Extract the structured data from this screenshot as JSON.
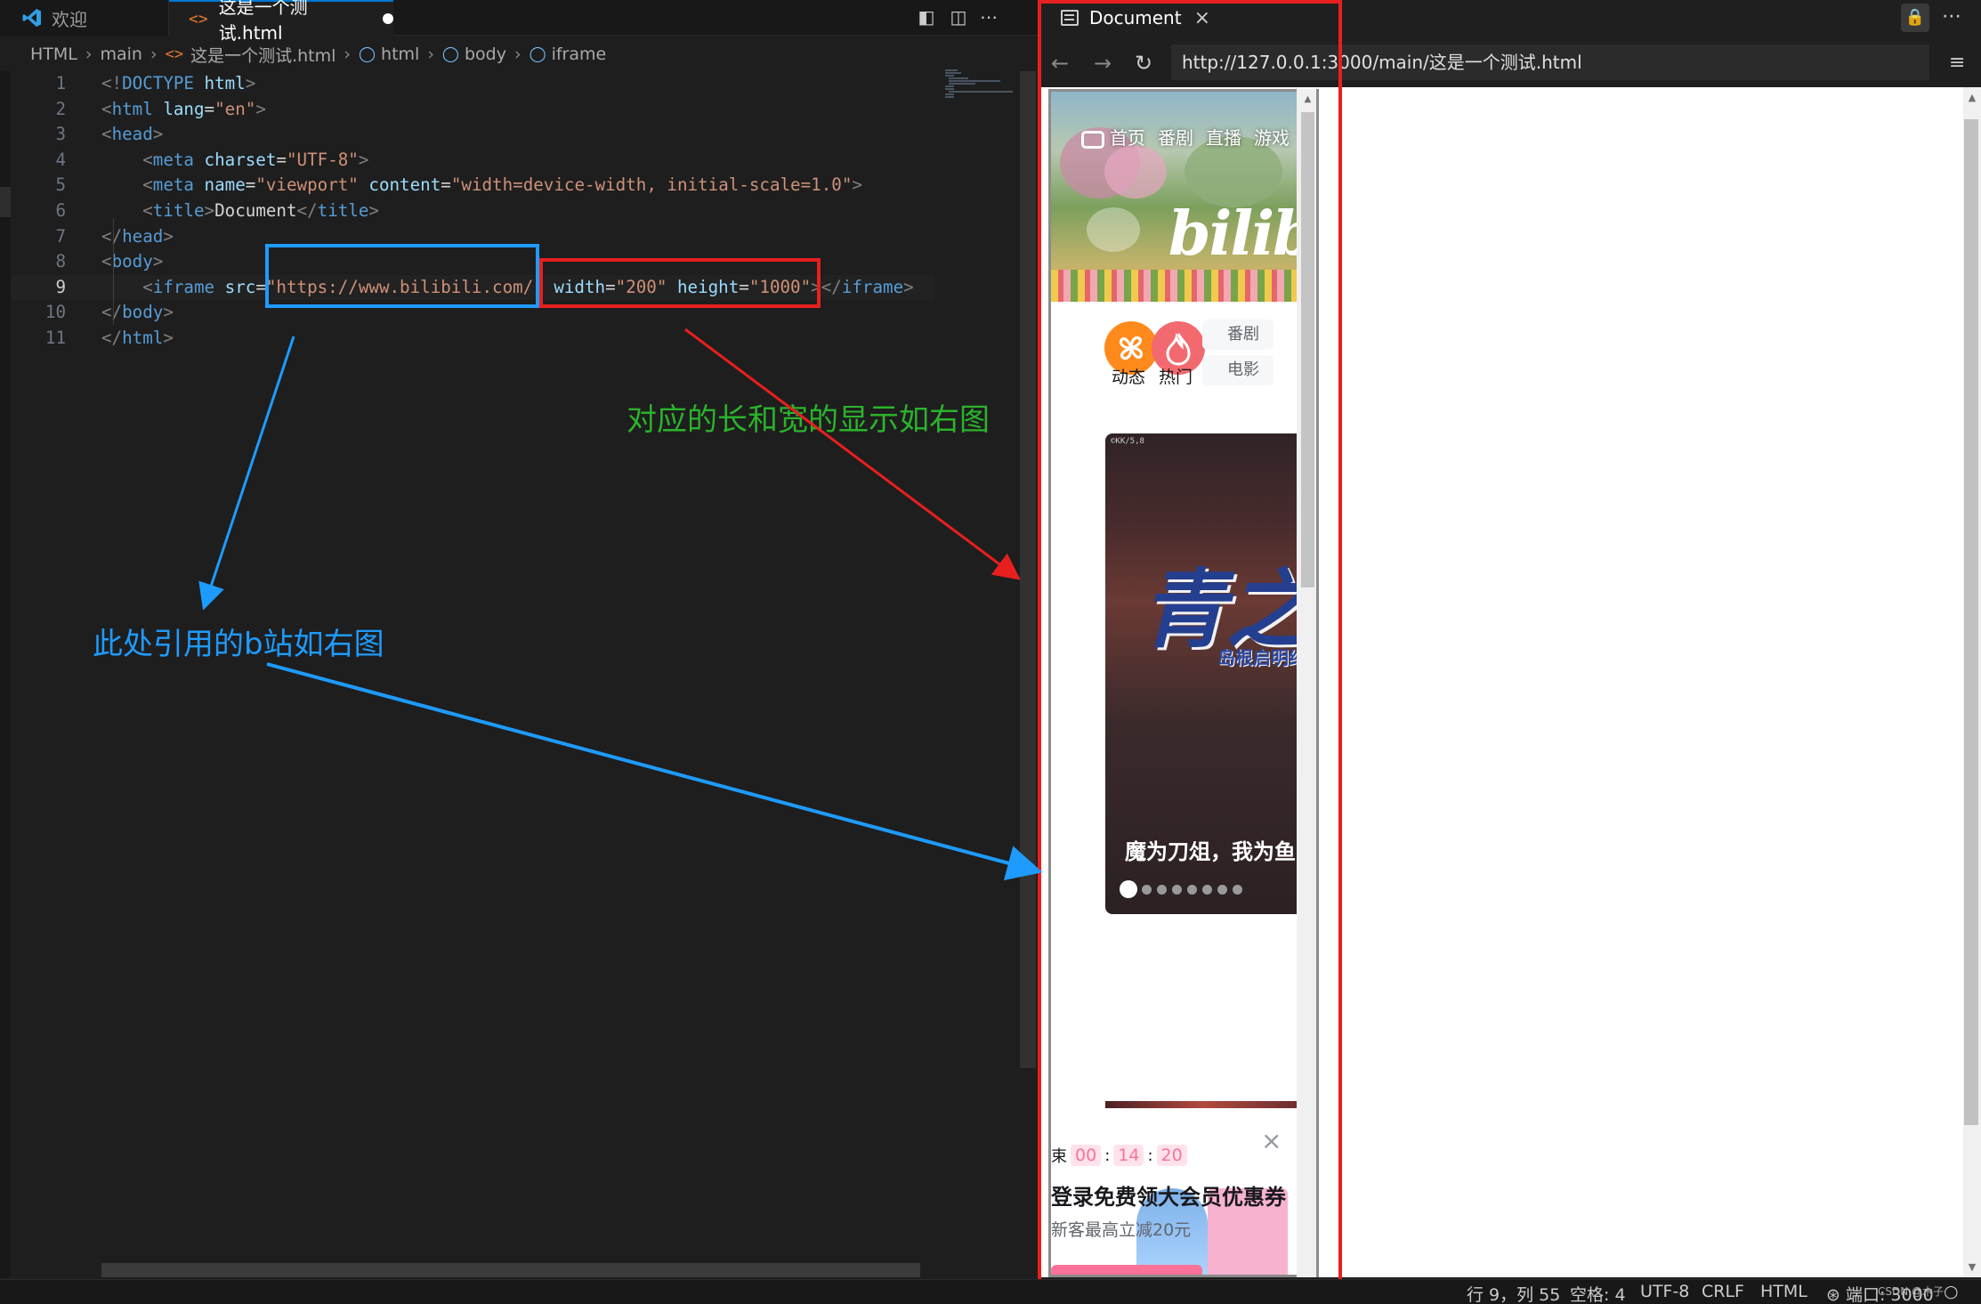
{
  "tabs": [
    {
      "label": "欢迎"
    },
    {
      "label": "这是一个测试.html"
    }
  ],
  "breadcrumb": [
    "HTML",
    "main",
    "这是一个测试.html",
    "html",
    "body",
    "iframe"
  ],
  "editor": {
    "current_line": 9,
    "lines": [
      {
        "n": "1",
        "tokens": [
          [
            "br",
            "<!"
          ],
          [
            "tag",
            "DOCTYPE "
          ],
          [
            "attr",
            "html"
          ],
          [
            "br",
            ">"
          ]
        ]
      },
      {
        "n": "2",
        "tokens": [
          [
            "br",
            "<"
          ],
          [
            "tag",
            "html "
          ],
          [
            "attr",
            "lang"
          ],
          [
            "txt",
            "="
          ],
          [
            "str",
            "\"en\""
          ],
          [
            "br",
            ">"
          ]
        ]
      },
      {
        "n": "3",
        "tokens": [
          [
            "br",
            "<"
          ],
          [
            "tag",
            "head"
          ],
          [
            "br",
            ">"
          ]
        ]
      },
      {
        "n": "4",
        "tokens": [
          [
            "txt",
            "    "
          ],
          [
            "br",
            "<"
          ],
          [
            "tag",
            "meta "
          ],
          [
            "attr",
            "charset"
          ],
          [
            "txt",
            "="
          ],
          [
            "str",
            "\"UTF-8\""
          ],
          [
            "br",
            ">"
          ]
        ]
      },
      {
        "n": "5",
        "tokens": [
          [
            "txt",
            "    "
          ],
          [
            "br",
            "<"
          ],
          [
            "tag",
            "meta "
          ],
          [
            "attr",
            "name"
          ],
          [
            "txt",
            "="
          ],
          [
            "str",
            "\"viewport\" "
          ],
          [
            "attr",
            "content"
          ],
          [
            "txt",
            "="
          ],
          [
            "str",
            "\"width=device-width, initial-scale=1.0\""
          ],
          [
            "br",
            ">"
          ]
        ]
      },
      {
        "n": "6",
        "tokens": [
          [
            "txt",
            "    "
          ],
          [
            "br",
            "<"
          ],
          [
            "tag",
            "title"
          ],
          [
            "br",
            ">"
          ],
          [
            "txt",
            "Document"
          ],
          [
            "br",
            "</"
          ],
          [
            "tag",
            "title"
          ],
          [
            "br",
            ">"
          ]
        ]
      },
      {
        "n": "7",
        "tokens": [
          [
            "br",
            "</"
          ],
          [
            "tag",
            "head"
          ],
          [
            "br",
            ">"
          ]
        ]
      },
      {
        "n": "8",
        "tokens": [
          [
            "br",
            "<"
          ],
          [
            "tag",
            "body"
          ],
          [
            "br",
            ">"
          ]
        ]
      },
      {
        "n": "9",
        "tokens": [
          [
            "txt",
            "    "
          ],
          [
            "br",
            "<"
          ],
          [
            "tag",
            "iframe "
          ],
          [
            "attr",
            "src"
          ],
          [
            "txt",
            "="
          ],
          [
            "str",
            "\"https://www.bilibili.com/\" "
          ],
          [
            "attr",
            "width"
          ],
          [
            "txt",
            "="
          ],
          [
            "str",
            "\"200\" "
          ],
          [
            "attr",
            "height"
          ],
          [
            "txt",
            "="
          ],
          [
            "str",
            "\"1000\""
          ],
          [
            "br",
            "></"
          ],
          [
            "tag",
            "iframe"
          ],
          [
            "br",
            ">"
          ]
        ]
      },
      {
        "n": "10",
        "tokens": [
          [
            "br",
            "</"
          ],
          [
            "tag",
            "body"
          ],
          [
            "br",
            ">"
          ]
        ]
      },
      {
        "n": "11",
        "tokens": [
          [
            "br",
            "</"
          ],
          [
            "tag",
            "html"
          ],
          [
            "br",
            ">"
          ]
        ]
      }
    ]
  },
  "browser": {
    "tab_title": "Document",
    "url": "http://127.0.0.1:3000/main/这是一个测试.html"
  },
  "bili": {
    "nav": [
      "首页",
      "番剧",
      "直播",
      "游戏"
    ],
    "logo": "bilibili",
    "channels": [
      {
        "label": "动态",
        "color": "#ff8a1c"
      },
      {
        "label": "热门",
        "color": "#f26a6f"
      }
    ],
    "channel_pills": [
      "番剧",
      "电影"
    ],
    "video_tag": "©KK/5,8",
    "video_art_title": "青之驱魔师",
    "video_art_sub": "岛根启明结社篇",
    "video_title": "魔为刀俎，我为鱼肉",
    "carousel_dots": 8,
    "promo": {
      "count_prefix": "束",
      "h": "00",
      "m": "14",
      "s": "20",
      "title": "登录免费领大会员优惠券",
      "sub": "新客最高立减20元"
    }
  },
  "annotations": {
    "size_note": "对应的长和宽的显示如右图",
    "site_note": "此处引用的b站如右图",
    "colors": {
      "red": "#e81f1f",
      "blue": "#1e9bff",
      "green": "#2bb32b"
    }
  },
  "status": {
    "position": "行 9，列 55",
    "spaces": "空格: 4",
    "encoding": "UTF-8",
    "eol": "CRLF",
    "language": "HTML",
    "port": "端口: 3000",
    "watermark": "CSDN @木子"
  }
}
